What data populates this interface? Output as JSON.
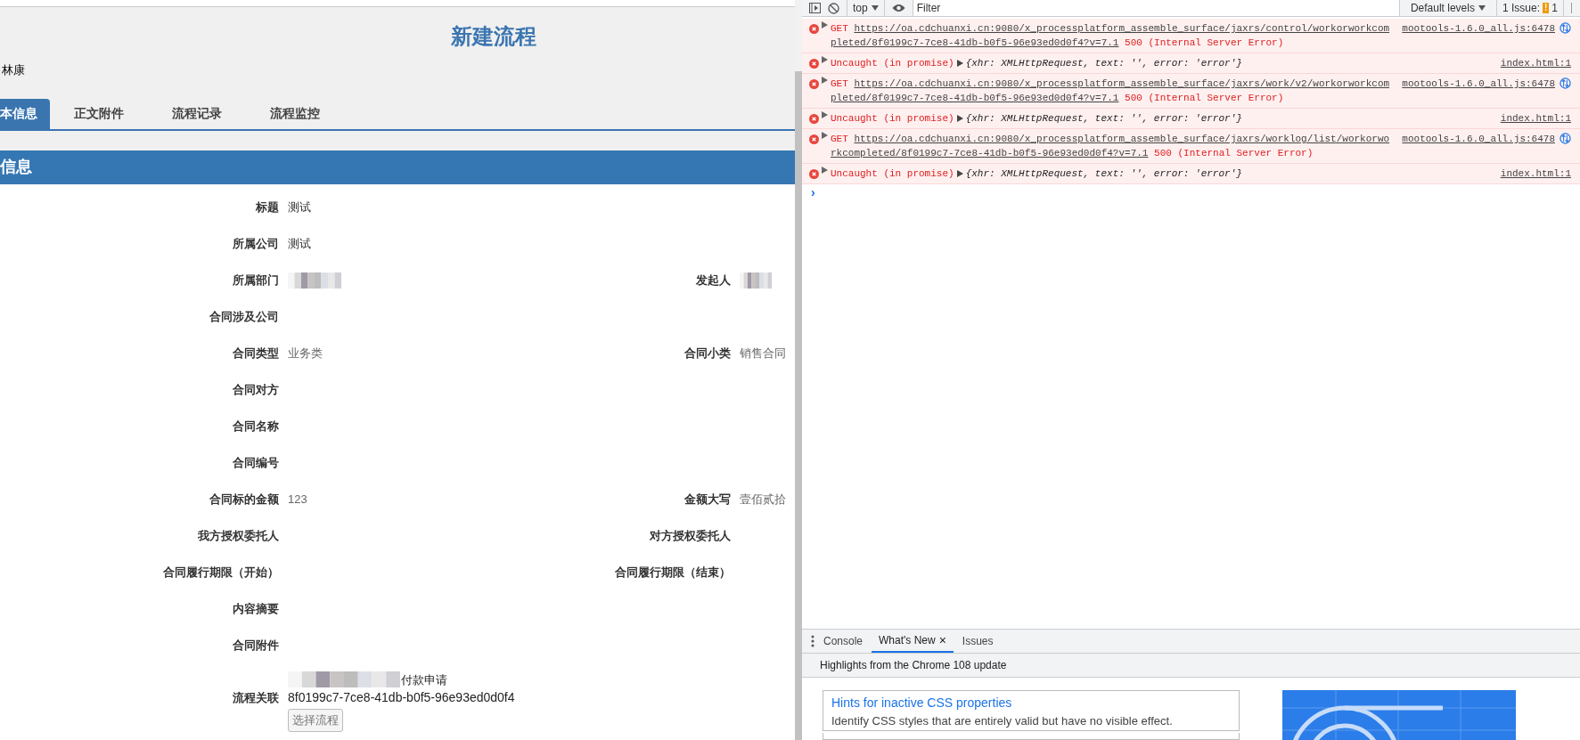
{
  "page": {
    "title": "新建流程",
    "user": "林康",
    "tabs": [
      {
        "label": "本信息",
        "selected": true
      },
      {
        "label": "正文附件",
        "selected": false
      },
      {
        "label": "流程记录",
        "selected": false
      },
      {
        "label": "流程监控",
        "selected": false
      }
    ],
    "section_title": "信息",
    "rows": [
      {
        "label": "标题",
        "value": "测试",
        "muted": false
      },
      {
        "label": "所属公司",
        "value": "测试",
        "muted": false
      },
      {
        "label": "所属部门",
        "redacted": true,
        "right_label": "发起人",
        "right_redacted": true
      },
      {
        "label": "合同涉及公司"
      },
      {
        "label": "合同类型",
        "value": "业务类",
        "muted": true,
        "right_label": "合同小类",
        "right_value": "销售合同"
      },
      {
        "label": "合同对方"
      },
      {
        "label": "合同名称"
      },
      {
        "label": "合同编号"
      },
      {
        "label": "合同标的金额",
        "value": "123",
        "muted": true,
        "right_label": "金额大写",
        "right_value": "壹佰贰拾"
      },
      {
        "label": "我方授权委托人",
        "right_label": "对方授权委托人"
      },
      {
        "label": "合同履行期限（开始）",
        "right_label": "合同履行期限（结束）"
      },
      {
        "label": "内容摘要"
      },
      {
        "label": "合同附件"
      }
    ],
    "linked_flow": {
      "label": "流程关联",
      "name": "付款申请",
      "id": "8f0199c7-7ce8-41db-b0f5-96e93ed0d0f4",
      "button": "选择流程"
    }
  },
  "devtools": {
    "context": "top",
    "filter_placeholder": "Filter",
    "levels": "Default levels",
    "issues": "1 Issue:",
    "issue_count": "1",
    "issue_badge": "!",
    "messages": [
      {
        "kind": "network",
        "method": "GET",
        "url": "https://oa.cdchuanxi.cn:9080/x_processplatform_assemble_surface/jaxrs/control/workorworkcompleted/8f0199c7-7ce8-41db-b0f5-96e93ed0d0f4?v=7.1",
        "status": "500 (Internal Server Error)",
        "source": "mootools-1.6.0_all.js:6478"
      },
      {
        "kind": "promise",
        "text": "Uncaught (in promise)",
        "object": "{xhr: XMLHttpRequest, text: '', error: 'error'}",
        "source": "index.html:1"
      },
      {
        "kind": "network",
        "method": "GET",
        "url": "https://oa.cdchuanxi.cn:9080/x_processplatform_assemble_surface/jaxrs/work/v2/workorworkcompleted/8f0199c7-7ce8-41db-b0f5-96e93ed0d0f4?v=7.1",
        "status": "500 (Internal Server Error)",
        "source": "mootools-1.6.0_all.js:6478"
      },
      {
        "kind": "promise",
        "text": "Uncaught (in promise)",
        "object": "{xhr: XMLHttpRequest, text: '', error: 'error'}",
        "source": "index.html:1"
      },
      {
        "kind": "network",
        "method": "GET",
        "url": "https://oa.cdchuanxi.cn:9080/x_processplatform_assemble_surface/jaxrs/worklog/list/workorworkcompleted/8f0199c7-7ce8-41db-b0f5-96e93ed0d0f4?v=7.1",
        "status": "500 (Internal Server Error)",
        "source": "mootools-1.6.0_all.js:6478"
      },
      {
        "kind": "promise",
        "text": "Uncaught (in promise)",
        "object": "{xhr: XMLHttpRequest, text: '', error: 'error'}",
        "source": "index.html:1"
      }
    ],
    "prompt": "›",
    "drawer_tabs": [
      {
        "label": "Console",
        "selected": false,
        "closable": false
      },
      {
        "label": "What's New",
        "selected": true,
        "closable": true
      },
      {
        "label": "Issues",
        "selected": false,
        "closable": false
      }
    ],
    "close_glyph": "×",
    "highlights": "Highlights from the Chrome 108 update",
    "card": {
      "title": "Hints for inactive CSS properties",
      "text": "Identify CSS styles that are entirely valid but have no visible effect."
    }
  }
}
